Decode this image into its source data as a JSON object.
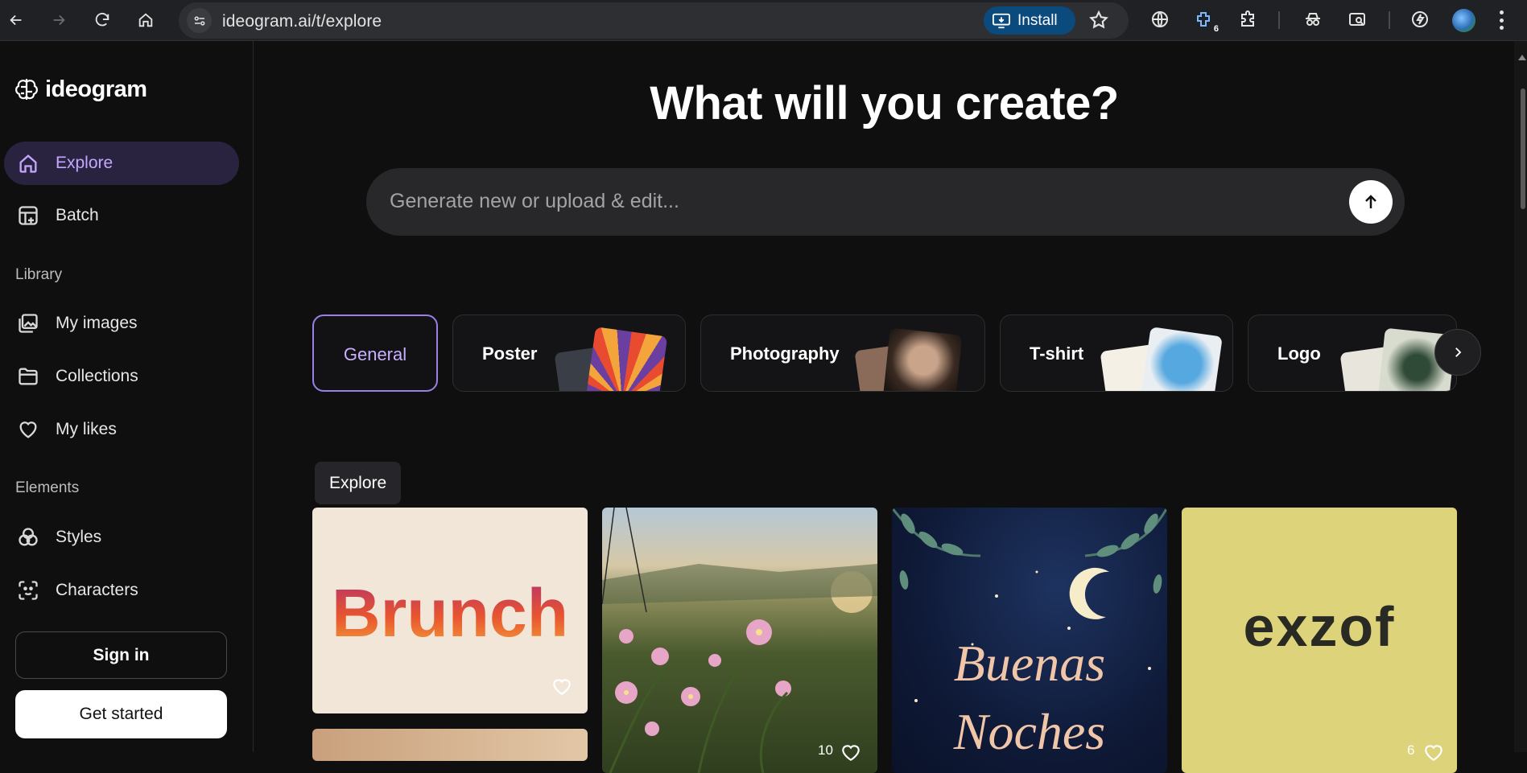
{
  "browser": {
    "url": "ideogram.ai/t/explore",
    "install_label": "Install",
    "extension_badge": "6"
  },
  "sidebar": {
    "logo_text": "ideogram",
    "items_top": [
      {
        "label": "Explore",
        "icon": "home-icon"
      },
      {
        "label": "Batch",
        "icon": "batch-icon"
      }
    ],
    "library_heading": "Library",
    "library_items": [
      {
        "label": "My images",
        "icon": "images-icon"
      },
      {
        "label": "Collections",
        "icon": "folder-icon"
      },
      {
        "label": "My likes",
        "icon": "heart-icon"
      }
    ],
    "elements_heading": "Elements",
    "element_items": [
      {
        "label": "Styles",
        "icon": "styles-icon"
      },
      {
        "label": "Characters",
        "icon": "characters-icon"
      }
    ],
    "signin_label": "Sign in",
    "getstarted_label": "Get started"
  },
  "main": {
    "headline": "What will you create?",
    "prompt_placeholder": "Generate new or upload & edit...",
    "categories": [
      {
        "label": "General"
      },
      {
        "label": "Poster"
      },
      {
        "label": "Photography"
      },
      {
        "label": "T-shirt"
      },
      {
        "label": "Logo"
      }
    ],
    "explore_tab": "Explore",
    "cards": [
      {
        "title_text": "Brunch"
      },
      {
        "like_count": "10"
      },
      {
        "title_text_1": "Buenas",
        "title_text_2": "Noches"
      },
      {
        "title_text": "exzof",
        "like_count": "6"
      }
    ]
  },
  "colors": {
    "accent": "#9a7fe6",
    "active_bg": "#2a2340",
    "page_bg": "#0f0f10"
  }
}
